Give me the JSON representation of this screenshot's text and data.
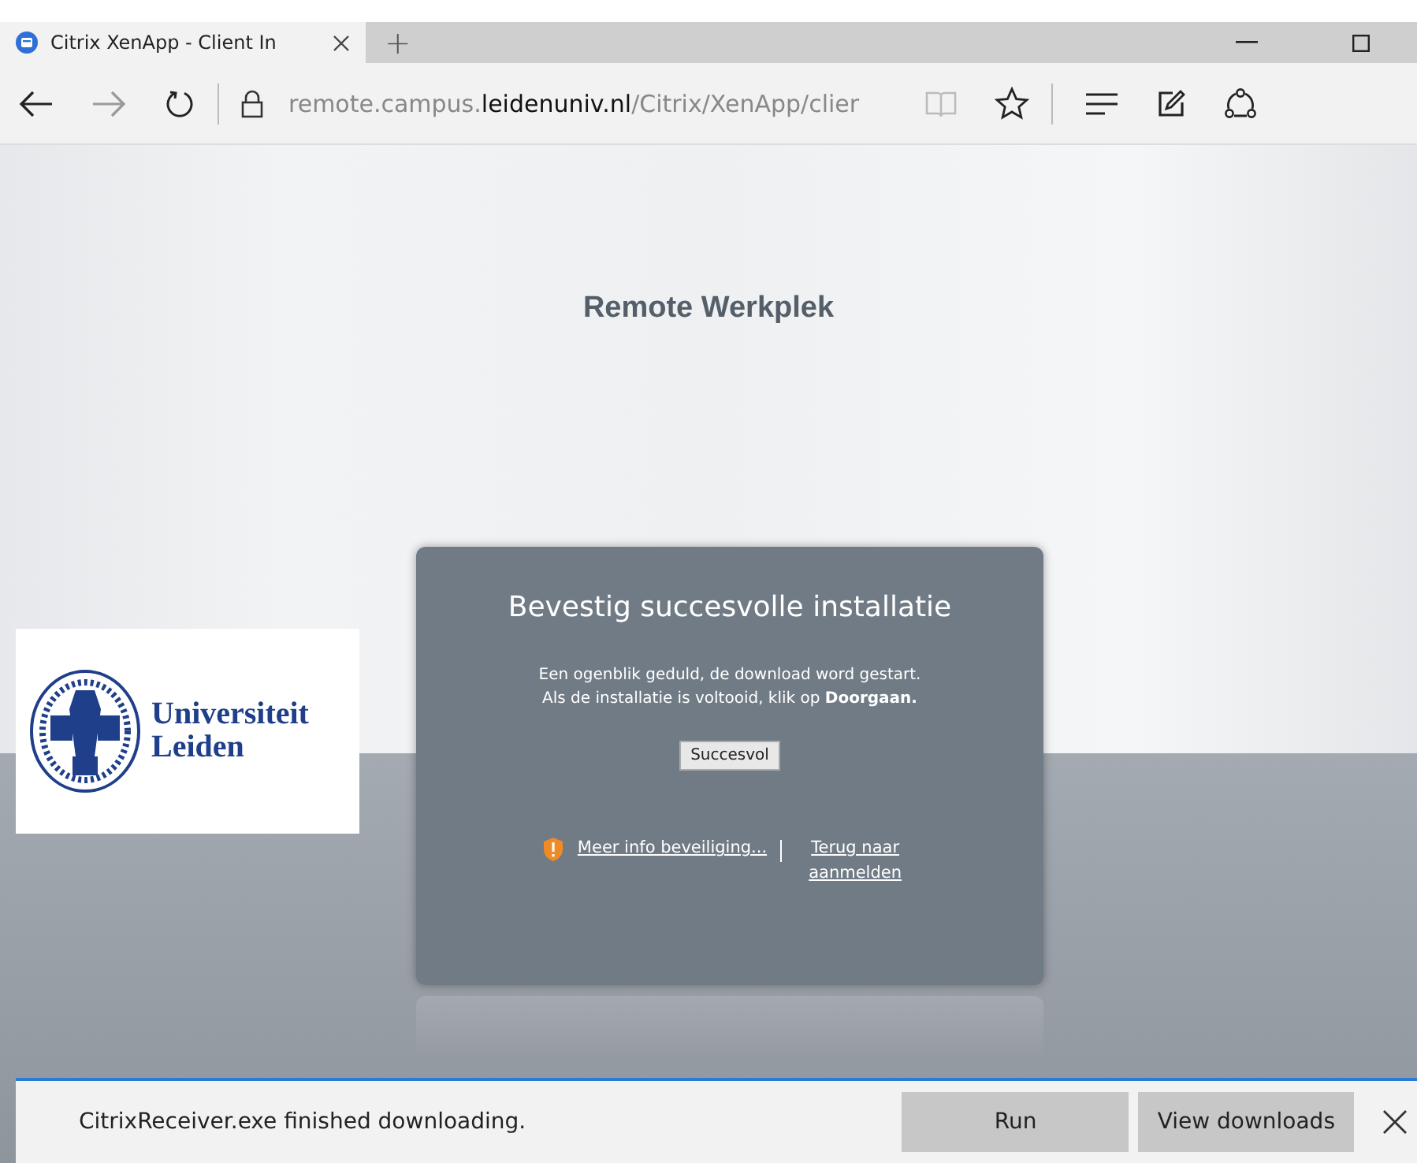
{
  "browser": {
    "tabs": [
      {
        "title": "Citrix XenApp - Client In",
        "selected": true
      }
    ],
    "new_tab": "+",
    "address": {
      "prefix": "remote.campus.",
      "domain": "leidenuniv.nl",
      "suffix": "/Citrix/XenApp/clier"
    }
  },
  "page": {
    "heading": "Remote Werkplek",
    "logo": {
      "line1": "Universiteit",
      "line2": "Leiden"
    },
    "dialog": {
      "title": "Bevestig succesvolle installatie",
      "message": [
        "Een ogenblik geduld, de download word gestart.",
        "Als de installatie is voltooid, klik op **Doorgaan.**"
      ],
      "button": "Succesvol",
      "links": [
        "Meer info beveiliging...",
        "Terug naar aanmelden"
      ]
    }
  },
  "download_bar": {
    "message": "CitrixReceiver.exe finished downloading.",
    "buttons": [
      "Run",
      "View downloads"
    ]
  }
}
